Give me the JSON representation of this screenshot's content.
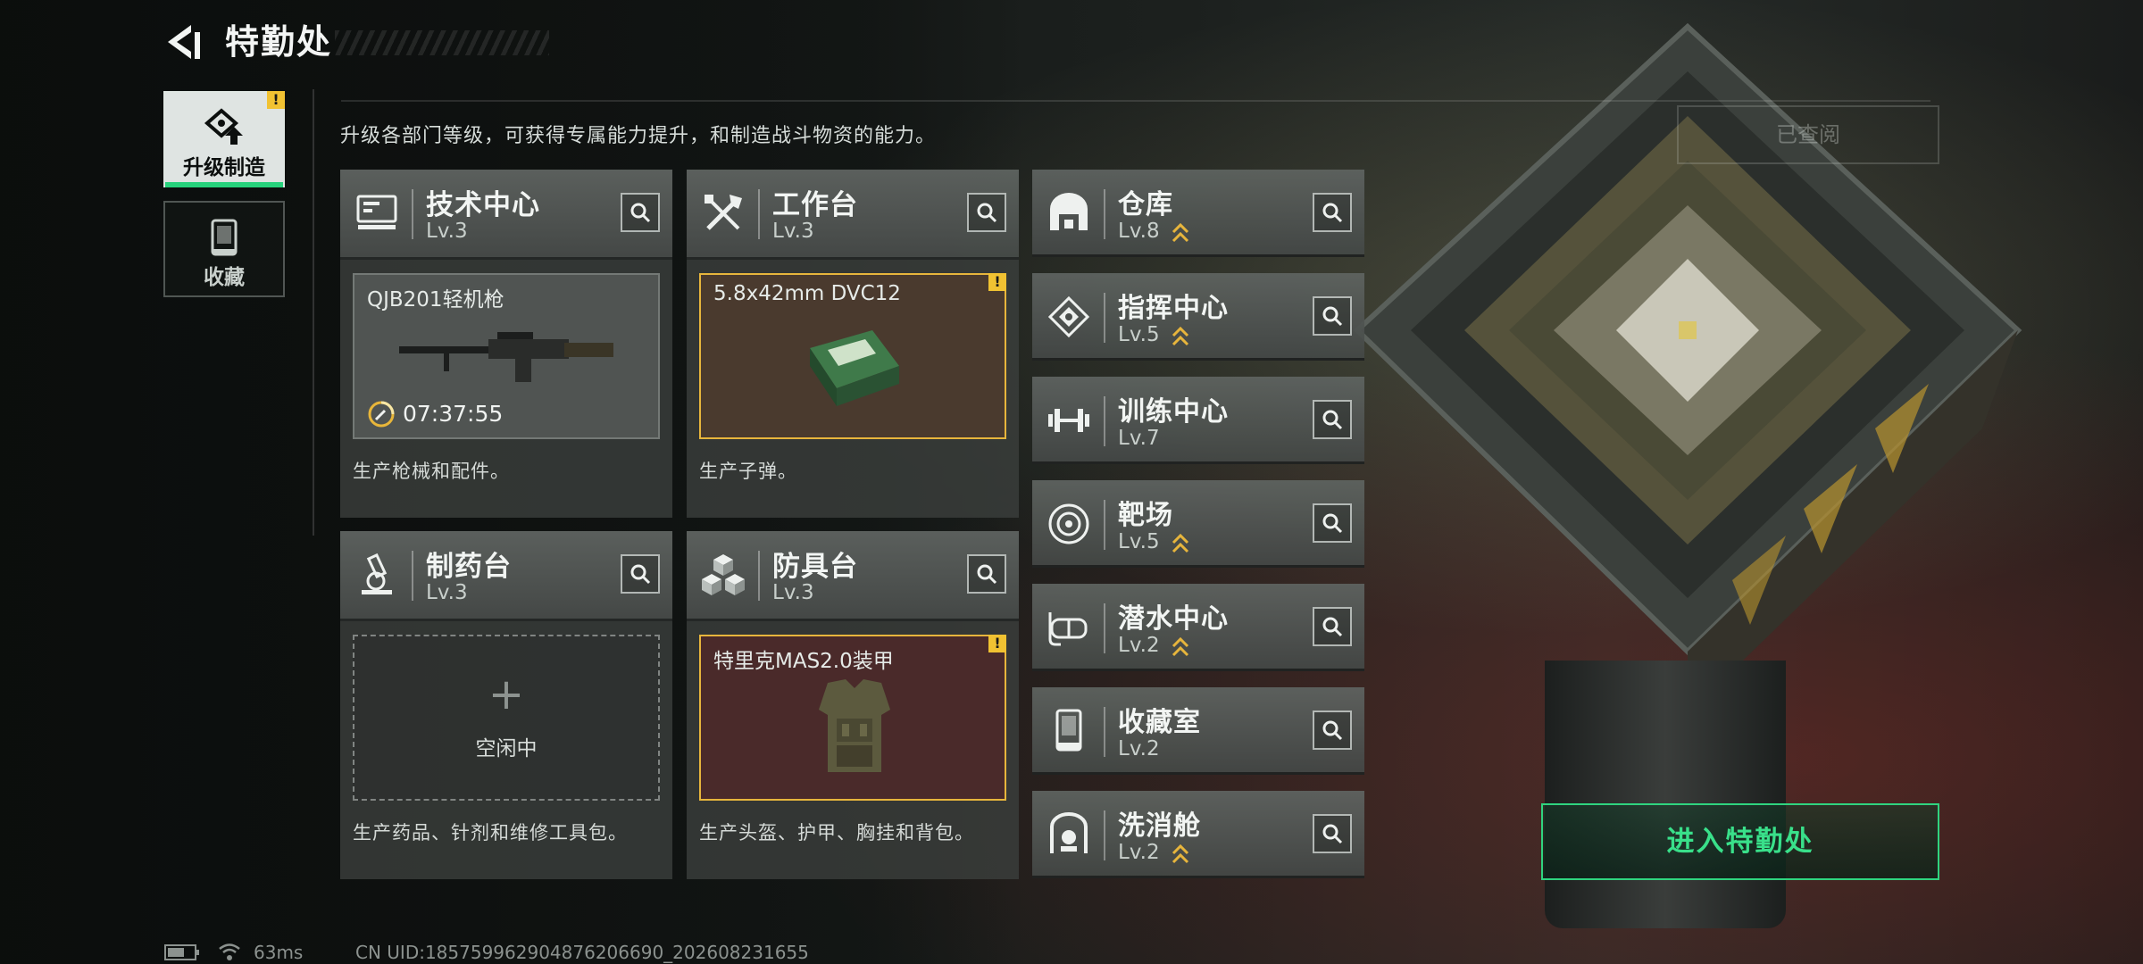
{
  "header": {
    "title": "特勤处"
  },
  "side_tabs": [
    {
      "label": "升级制造",
      "icon": "upgrade-craft-icon",
      "active": true,
      "alert": "!"
    },
    {
      "label": "收藏",
      "icon": "collection-icon",
      "active": false
    }
  ],
  "intro": "升级各部门等级，可获得专属能力提升，和制造战斗物资的能力。",
  "facilities": {
    "tech_center": {
      "name": "技术中心",
      "level": "Lv.3",
      "icon": "computer-icon",
      "slot_item": "QJB201轻机枪",
      "timer": "07:37:55",
      "desc": "生产枪械和配件。"
    },
    "workbench": {
      "name": "工作台",
      "level": "Lv.3",
      "icon": "tools-icon",
      "slot_item": "5.8x42mm DVC12",
      "alert": "!",
      "desc": "生产子弹。"
    },
    "pharmacy": {
      "name": "制药台",
      "level": "Lv.3",
      "icon": "microscope-icon",
      "slot_plus": "+",
      "slot_status": "空闲中",
      "desc": "生产药品、针剂和维修工具包。"
    },
    "armor_bench": {
      "name": "防具台",
      "level": "Lv.3",
      "icon": "armor-blocks-icon",
      "slot_item": "特里克MAS2.0装甲",
      "alert": "!",
      "desc": "生产头盔、护甲、胸挂和背包。"
    }
  },
  "facility_list": [
    {
      "name": "仓库",
      "level": "Lv.8",
      "upgradable": true,
      "icon": "warehouse-icon"
    },
    {
      "name": "指挥中心",
      "level": "Lv.5",
      "upgradable": true,
      "icon": "command-center-icon"
    },
    {
      "name": "训练中心",
      "level": "Lv.7",
      "upgradable": false,
      "icon": "dumbbell-icon"
    },
    {
      "name": "靶场",
      "level": "Lv.5",
      "upgradable": true,
      "icon": "target-range-icon"
    },
    {
      "name": "潜水中心",
      "level": "Lv.2",
      "upgradable": true,
      "icon": "diving-mask-icon"
    },
    {
      "name": "收藏室",
      "level": "Lv.2",
      "upgradable": false,
      "icon": "collection-room-icon"
    },
    {
      "name": "洗消舱",
      "level": "Lv.2",
      "upgradable": true,
      "icon": "decontamination-icon"
    }
  ],
  "right_panel": {
    "viewed_label": "已查阅",
    "enter_label": "进入特勤处"
  },
  "status": {
    "ping": "63ms",
    "uid": "CN UID:18575996290487620669​0_20260823​1655"
  },
  "colors": {
    "accent_green": "#2fd47f",
    "alert_yellow": "#f1c232",
    "upgrade_gold": "#e7b53c"
  }
}
